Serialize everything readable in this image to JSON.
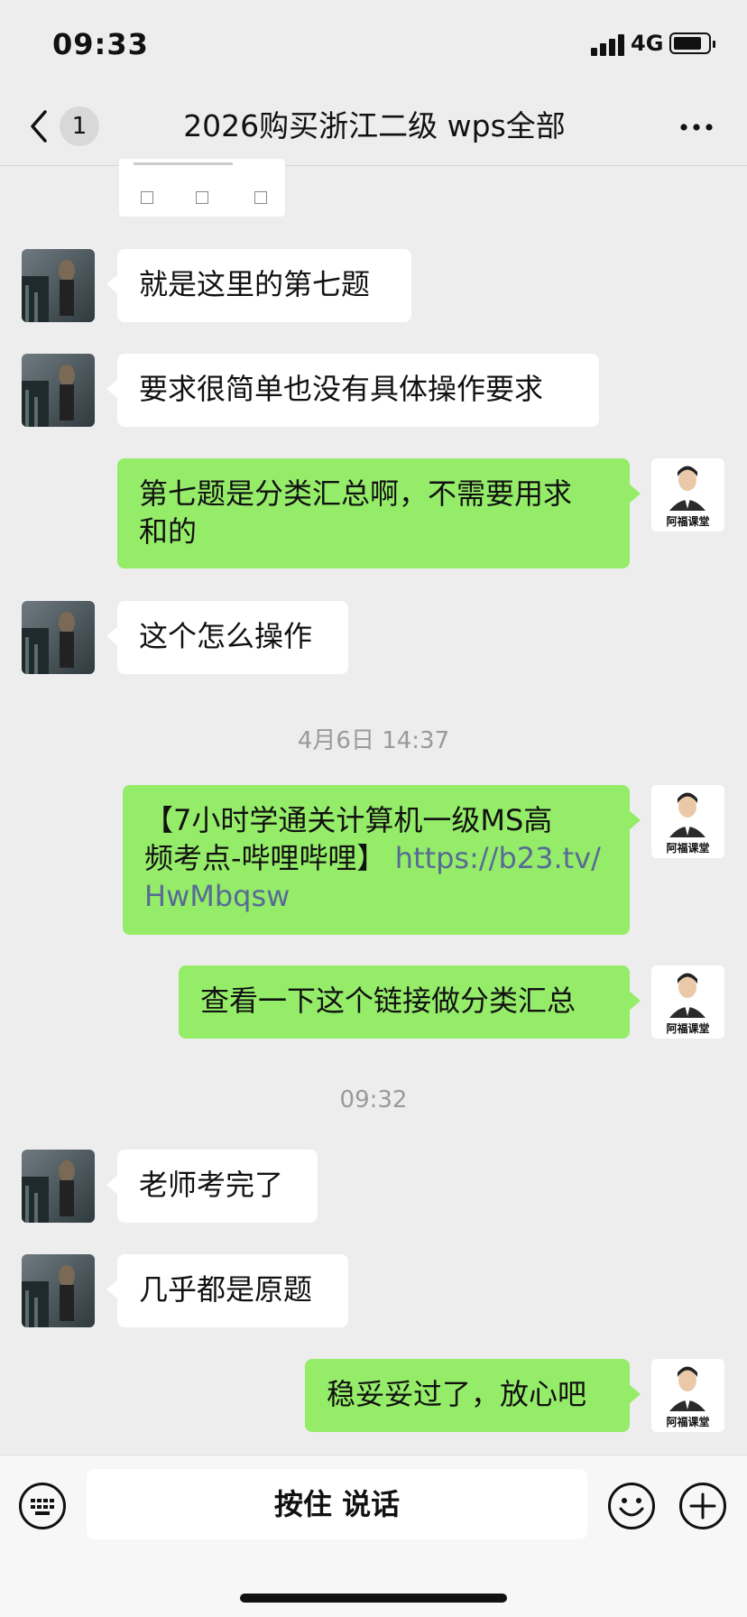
{
  "status_bar": {
    "time": "09:33",
    "network": "4G"
  },
  "nav": {
    "unread_count": "1",
    "title": "2026购买浙江二级 wps全部"
  },
  "messages": [
    {
      "side": "in",
      "text": "就是这里的第七题"
    },
    {
      "side": "in",
      "text": "要求很简单也没有具体操作要求"
    },
    {
      "side": "out",
      "line1": "第七题是分类汇总啊，不需要用求",
      "line2": "和的"
    },
    {
      "side": "in",
      "text": "这个怎么操作"
    },
    {
      "side": "out",
      "line1": "【7小时学通关计算机一级MS高",
      "line2_prefix": "频考点-哔哩哔哩】",
      "link_part1": "https://b23.tv/",
      "link_part2": "HwMbqsw"
    },
    {
      "side": "out",
      "text": "查看一下这个链接做分类汇总"
    },
    {
      "side": "in",
      "text": "老师考完了"
    },
    {
      "side": "in",
      "text": "几乎都是原题"
    },
    {
      "side": "out",
      "text": "稳妥妥过了，放心吧"
    }
  ],
  "timestamps": [
    "4月6日 14:37",
    "09:32"
  ],
  "avatar_label": "阿福课堂",
  "input_bar": {
    "voice_label": "按住 说话"
  },
  "colors": {
    "background": "#ededed",
    "outgoing_bubble": "#95ec69",
    "incoming_bubble": "#ffffff",
    "link": "#576b95"
  }
}
